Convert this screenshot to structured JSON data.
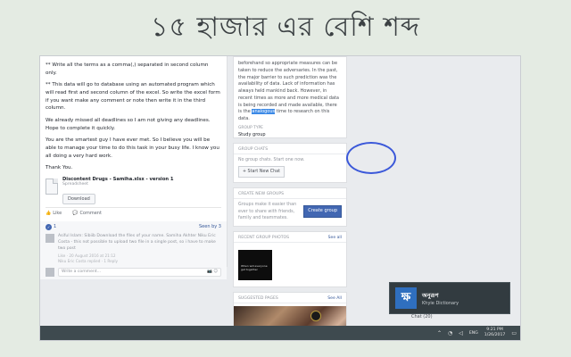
{
  "banner": {
    "title": "১৫ হাজার এর বেশি শব্দ"
  },
  "post": {
    "paragraphs": [
      "** Write all the terms as a comma(,) separated in second column only.",
      "** This data will go to database using an automated program which will read first and second column of the excel. So write the excel form if you want make any comment or note then write it in the third column.",
      "We already missed all deadlines so I am not giving any deadlines. Hope to complete it quickly.",
      "You are the smartest guy I have ever met. So I believe you will be able to manage your time to do this task in your busy life. I know you all doing a very hard work.",
      "Thank You."
    ],
    "attachment": {
      "name": "Discontent Drugs - Samiha.xlsx - version 1",
      "type": "Spreadsheet",
      "download_label": "Download"
    },
    "actions": {
      "like": "Like",
      "comment": "Comment"
    },
    "like_count": "1",
    "seen_by": "Seen by 3",
    "comment": {
      "text": "Asiful Islam: Sibiib Download the files of your name. Samiha Akhter Niku Eric Costa - this not possible to upload two file in a single post, so i have to make two post",
      "meta": "Like · 20 August 2016 at 21:12",
      "reply": "Niku Eric Costa replied · 1 Reply"
    },
    "write_placeholder": "Write a comment..."
  },
  "sidebar": {
    "description": {
      "text_before": "beforehand so appropriate measures can be taken to reduce the adversaries. In the past, the major barrier to such prediction was the availability of data. Lack of information has always held mankind back. However, in recent times as more and more medical data is being recorded and made available, there is the ",
      "highlight": "analogous",
      "text_after": " time to research on this data.",
      "group_type_label": "Group type",
      "group_type_value": "Study group"
    },
    "group_chats": {
      "heading": "Group chats",
      "body": "No group chats. Start one now.",
      "button": "+ Start New Chat"
    },
    "create_groups": {
      "heading": "Create new groups",
      "body": "Groups make it easier than ever to share with friends, family and teammates.",
      "button": "Create group"
    },
    "recent_photos": {
      "heading": "Recent group photos",
      "see_all": "See all",
      "thumb_caption": "When will everyone get together"
    },
    "suggested_pages": {
      "heading": "Suggested pages",
      "see_all": "See All"
    },
    "chat_label": "Chat (20)"
  },
  "toast": {
    "title": "অনুরূপ",
    "subtitle": "Khyie Dictionary",
    "logo": "ক্ষ"
  },
  "taskbar": {
    "lang": "ENG",
    "time": "9:21 PM",
    "date": "1/26/2017"
  }
}
